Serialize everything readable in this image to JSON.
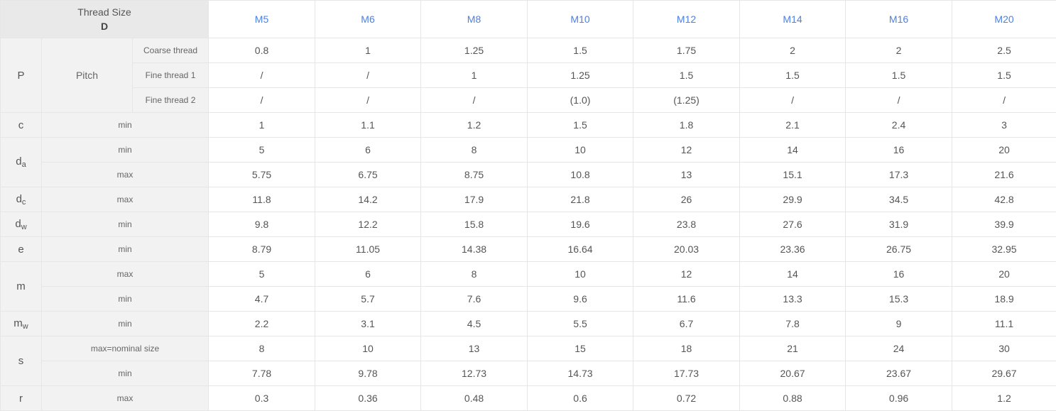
{
  "header": {
    "corner_line1": "Thread Size",
    "corner_line2": "D",
    "sizes": [
      "M5",
      "M6",
      "M8",
      "M10",
      "M12",
      "M14",
      "M16",
      "M20"
    ]
  },
  "pitch": {
    "symbol": "P",
    "label": "Pitch",
    "rows": [
      {
        "label": "Coarse thread",
        "values": [
          "0.8",
          "1",
          "1.25",
          "1.5",
          "1.75",
          "2",
          "2",
          "2.5"
        ]
      },
      {
        "label": "Fine thread 1",
        "values": [
          "/",
          "/",
          "1",
          "1.25",
          "1.5",
          "1.5",
          "1.5",
          "1.5"
        ]
      },
      {
        "label": "Fine thread 2",
        "values": [
          "/",
          "/",
          "/",
          "(1.0)",
          "(1.25)",
          "/",
          "/",
          "/"
        ]
      }
    ]
  },
  "params": [
    {
      "symbol": "c",
      "sub": "",
      "rows": [
        {
          "label": "min",
          "values": [
            "1",
            "1.1",
            "1.2",
            "1.5",
            "1.8",
            "2.1",
            "2.4",
            "3"
          ]
        }
      ]
    },
    {
      "symbol": "d",
      "sub": "a",
      "rows": [
        {
          "label": "min",
          "values": [
            "5",
            "6",
            "8",
            "10",
            "12",
            "14",
            "16",
            "20"
          ]
        },
        {
          "label": "max",
          "values": [
            "5.75",
            "6.75",
            "8.75",
            "10.8",
            "13",
            "15.1",
            "17.3",
            "21.6"
          ]
        }
      ]
    },
    {
      "symbol": "d",
      "sub": "c",
      "rows": [
        {
          "label": "max",
          "values": [
            "11.8",
            "14.2",
            "17.9",
            "21.8",
            "26",
            "29.9",
            "34.5",
            "42.8"
          ]
        }
      ]
    },
    {
      "symbol": "d",
      "sub": "w",
      "rows": [
        {
          "label": "min",
          "values": [
            "9.8",
            "12.2",
            "15.8",
            "19.6",
            "23.8",
            "27.6",
            "31.9",
            "39.9"
          ]
        }
      ]
    },
    {
      "symbol": "e",
      "sub": "",
      "rows": [
        {
          "label": "min",
          "values": [
            "8.79",
            "11.05",
            "14.38",
            "16.64",
            "20.03",
            "23.36",
            "26.75",
            "32.95"
          ]
        }
      ]
    },
    {
      "symbol": "m",
      "sub": "",
      "rows": [
        {
          "label": "max",
          "values": [
            "5",
            "6",
            "8",
            "10",
            "12",
            "14",
            "16",
            "20"
          ]
        },
        {
          "label": "min",
          "values": [
            "4.7",
            "5.7",
            "7.6",
            "9.6",
            "11.6",
            "13.3",
            "15.3",
            "18.9"
          ]
        }
      ]
    },
    {
      "symbol": "m",
      "sub": "w",
      "rows": [
        {
          "label": "min",
          "values": [
            "2.2",
            "3.1",
            "4.5",
            "5.5",
            "6.7",
            "7.8",
            "9",
            "11.1"
          ]
        }
      ]
    },
    {
      "symbol": "s",
      "sub": "",
      "rows": [
        {
          "label": "max=nominal size",
          "values": [
            "8",
            "10",
            "13",
            "15",
            "18",
            "21",
            "24",
            "30"
          ]
        },
        {
          "label": "min",
          "values": [
            "7.78",
            "9.78",
            "12.73",
            "14.73",
            "17.73",
            "20.67",
            "23.67",
            "29.67"
          ]
        }
      ]
    },
    {
      "symbol": "r",
      "sub": "",
      "rows": [
        {
          "label": "max",
          "values": [
            "0.3",
            "0.36",
            "0.48",
            "0.6",
            "0.72",
            "0.88",
            "0.96",
            "1.2"
          ]
        }
      ]
    }
  ],
  "colors": {
    "size_header": "#4a80e8",
    "label_bg": "#f2f2f2",
    "corner_bg": "#e9e9e9",
    "border": "#e6e6e6"
  }
}
